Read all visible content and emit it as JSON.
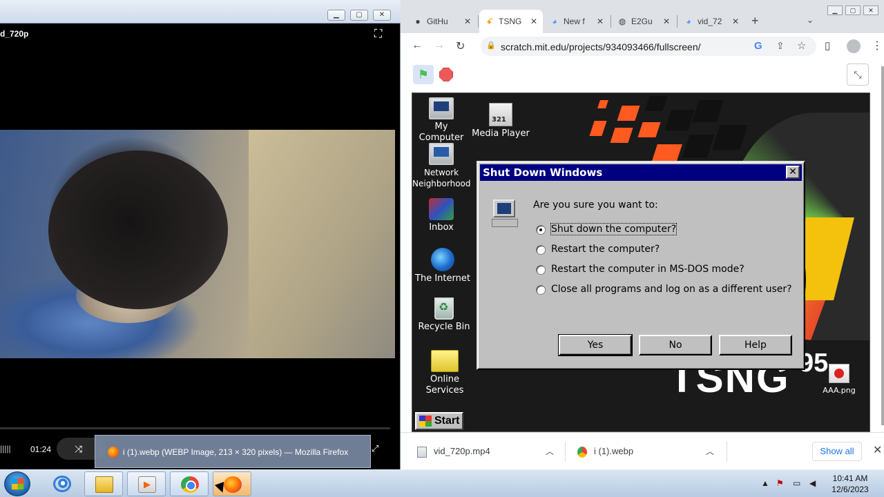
{
  "player": {
    "filename": "d_720p",
    "time": "01:24",
    "tooltip": "i (1).webp (WEBP Image, 213 × 320 pixels) — Mozilla Firefox"
  },
  "chrome": {
    "tabs": [
      {
        "label": "GitHu",
        "icon": "github-icon"
      },
      {
        "label": "TSNG",
        "icon": "scratch-icon"
      },
      {
        "label": "New f",
        "icon": "scratch-icon"
      },
      {
        "label": "E2Gu",
        "icon": "globe-icon"
      },
      {
        "label": "vid_72",
        "icon": "scratch-icon"
      }
    ],
    "url": "scratch.mit.edu/projects/934093466/fullscreen/",
    "downloads": [
      {
        "name": "vid_720p.mp4"
      },
      {
        "name": "i (1).webp"
      }
    ],
    "show_all": "Show all"
  },
  "desktop": {
    "icons": [
      {
        "label": "My Computer"
      },
      {
        "label": "Network Neighborhood"
      },
      {
        "label": "Inbox"
      },
      {
        "label": "The Internet"
      },
      {
        "label": "Recycle Bin"
      },
      {
        "label": "Online Services"
      },
      {
        "label": "Media Player"
      },
      {
        "label": "AAA.png"
      }
    ],
    "brand": "TSNG",
    "brand_version": "95",
    "start_label": "Start"
  },
  "dialog": {
    "title": "Shut Down Windows",
    "question": "Are you sure you want to:",
    "options": [
      "Shut down the computer?",
      "Restart the computer?",
      "Restart the computer in MS-DOS mode?",
      "Close all programs and log on as a different user?"
    ],
    "selected_option": 0,
    "buttons": {
      "yes": "Yes",
      "no": "No",
      "help": "Help"
    }
  },
  "taskbar": {
    "clock_time": "10:41 AM",
    "clock_date": "12/6/2023"
  },
  "colors": {
    "dialog_titlebar": "#000080",
    "win95_face": "#c0c0c0",
    "chrome_frame": "#dee1e6",
    "link_blue": "#1a73e8"
  }
}
